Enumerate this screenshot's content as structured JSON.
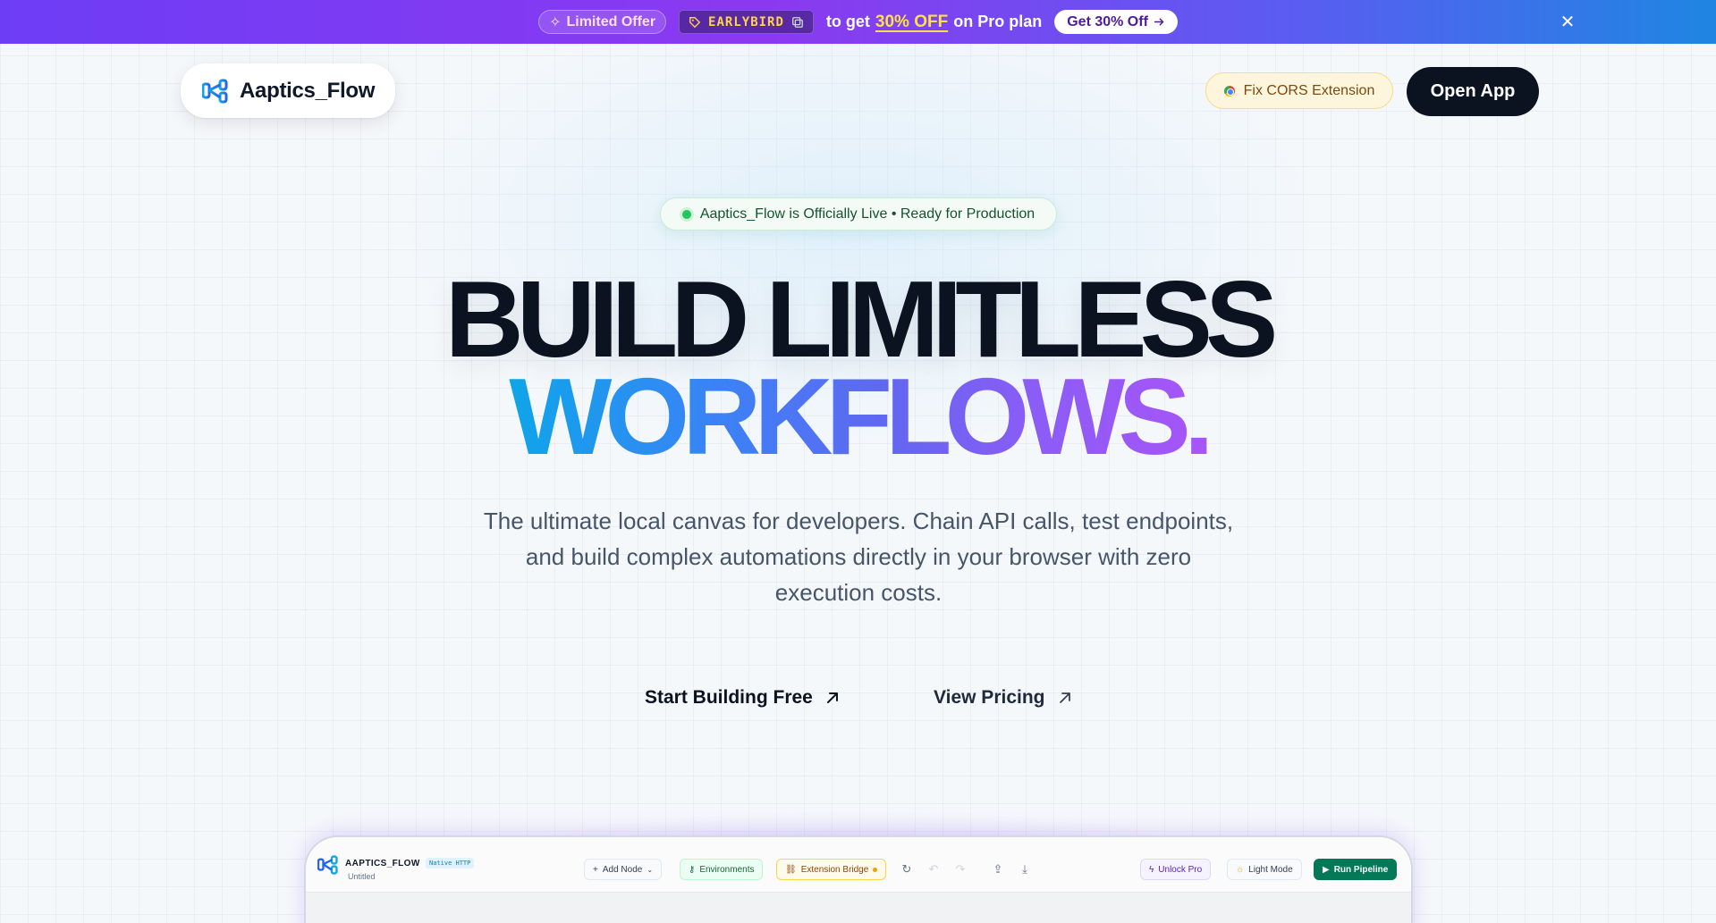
{
  "promo": {
    "offer_label": "Limited Offer",
    "code": "EARLYBIRD",
    "text_prefix": "to get",
    "text_highlight": "30% OFF",
    "text_suffix": "on Pro plan",
    "cta_label": "Get 30% Off",
    "close_symbol": "✕"
  },
  "nav": {
    "brand_name": "Aaptics_Flow",
    "cors_label": "Fix CORS Extension",
    "open_app_label": "Open App"
  },
  "hero": {
    "badge_text": "Aaptics_Flow is Officially Live • Ready for Production",
    "headline_line1": "BUILD LIMITLESS",
    "headline_line2": "WORKFLOWS.",
    "subtitle": "The ultimate local canvas for developers. Chain API calls, test endpoints, and build complex automations directly in your browser with zero execution costs.",
    "cta_primary": "Start Building Free",
    "cta_secondary": "View Pricing"
  },
  "preview": {
    "title": "AAPTICS_FLOW",
    "tag": "Native HTTP",
    "subtitle": "Untitled",
    "add_node": "Add Node",
    "environments": "Environments",
    "extension_bridge": "Extension Bridge",
    "unlock_pro": "Unlock Pro",
    "light_mode": "Light Mode",
    "run_pipeline": "Run Pipeline"
  },
  "colors": {
    "accent_dark": "#0b1220",
    "gradient_start": "#0ea5e9",
    "gradient_end": "#a855f7",
    "live_green": "#22c55e",
    "promo_purple": "#6d3df5"
  },
  "icons": {
    "promo_offer": "sparkle-icon",
    "promo_code": "tag-icon",
    "promo_copy": "copy-icon",
    "promo_arrow": "arrow-right-icon",
    "cta_arrow": "arrow-up-right-icon",
    "brand": "flow-logo-icon"
  }
}
